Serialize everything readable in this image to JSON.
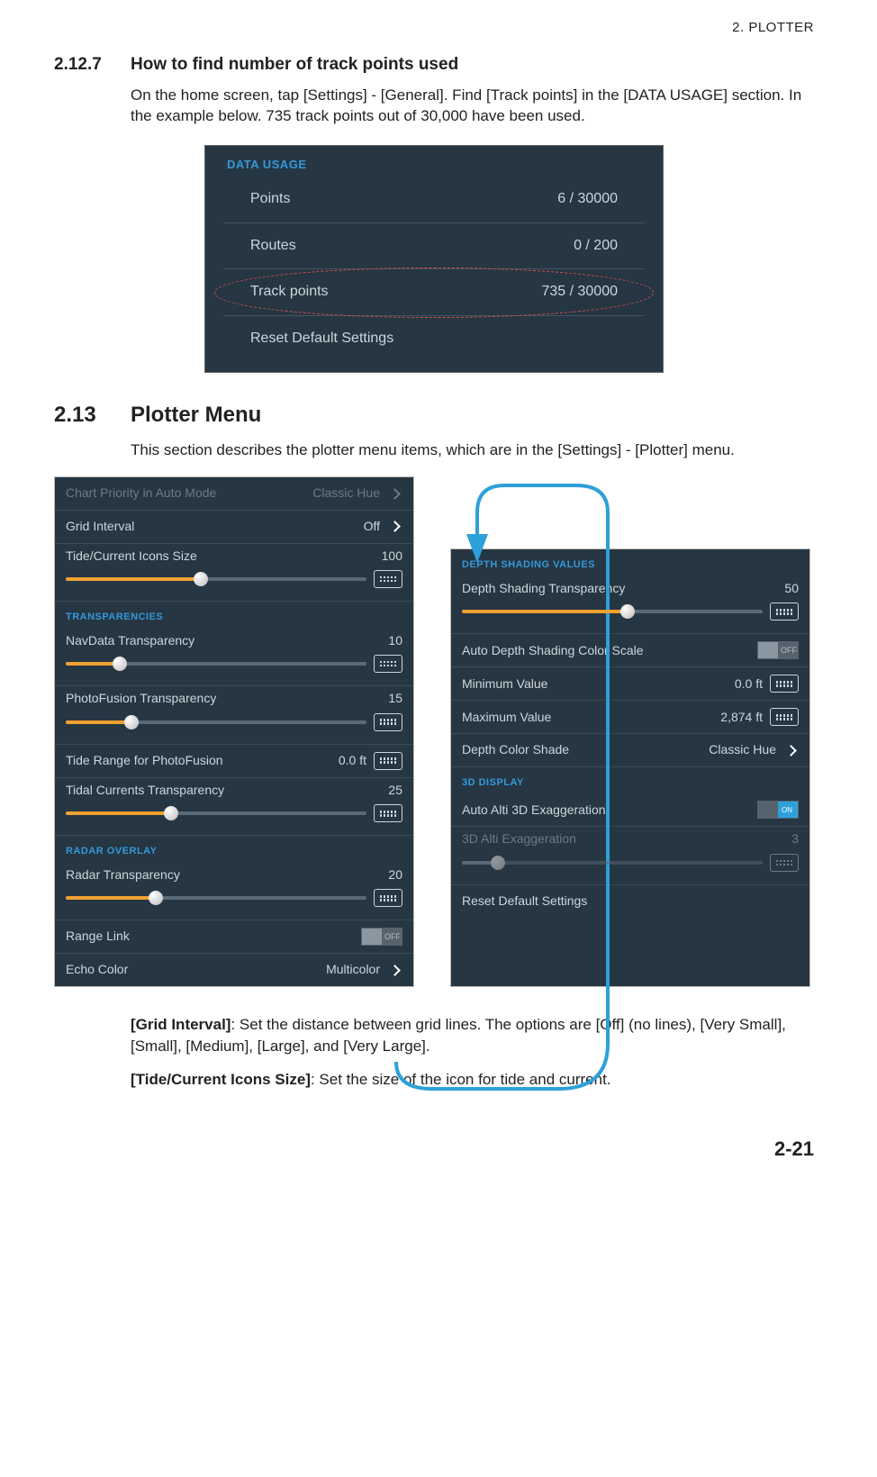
{
  "header": {
    "chapter": "2.  PLOTTER"
  },
  "section1": {
    "num": "2.12.7",
    "title": "How to find number of track points used",
    "body": "On the home screen, tap [Settings] - [General]. Find [Track points] in the [DATA USAGE] section. In the example below. 735 track points out of 30,000 have been used."
  },
  "data_usage": {
    "title": "DATA USAGE",
    "rows": [
      {
        "label": "Points",
        "value": "6 / 30000"
      },
      {
        "label": "Routes",
        "value": "0 / 200"
      },
      {
        "label": "Track points",
        "value": "735 / 30000"
      },
      {
        "label": "Reset Default Settings",
        "value": ""
      }
    ]
  },
  "section2": {
    "num": "2.13",
    "title": "Plotter Menu",
    "body": "This section describes the plotter menu items, which are in the [Settings] - [Plotter] menu."
  },
  "panel_left": {
    "chart_priority": {
      "label": "Chart Priority in Auto Mode",
      "value": "Classic Hue"
    },
    "grid_interval": {
      "label": "Grid Interval",
      "value": "Off"
    },
    "tide_icons": {
      "label": "Tide/Current Icons Size",
      "value": "100",
      "percent": 45
    },
    "trans_title": "TRANSPARENCIES",
    "navdata": {
      "label": "NavData Transparency",
      "value": "10",
      "percent": 18
    },
    "photo": {
      "label": "PhotoFusion Transparency",
      "value": "15",
      "percent": 22
    },
    "tide_range": {
      "label": "Tide Range for PhotoFusion",
      "value": "0.0 ft"
    },
    "tidal_curr": {
      "label": "Tidal Currents Transparency",
      "value": "25",
      "percent": 35
    },
    "radar_title": "RADAR OVERLAY",
    "radar_trans": {
      "label": "Radar Transparency",
      "value": "20",
      "percent": 30
    },
    "range_link": {
      "label": "Range Link",
      "value": "OFF"
    },
    "echo": {
      "label": "Echo Color",
      "value": "Multicolor"
    }
  },
  "panel_right": {
    "depth_title": "DEPTH SHADING VALUES",
    "depth_trans": {
      "label": "Depth Shading Transparency",
      "value": "50",
      "percent": 55
    },
    "auto_color": {
      "label": "Auto Depth Shading Color Scale",
      "value": "OFF"
    },
    "min": {
      "label": "Minimum Value",
      "value": "0.0 ft"
    },
    "max": {
      "label": "Maximum Value",
      "value": "2,874 ft"
    },
    "shade": {
      "label": "Depth Color Shade",
      "value": "Classic Hue"
    },
    "d3_title": "3D DISPLAY",
    "auto_alti": {
      "label": "Auto Alti 3D Exaggeration",
      "value": "ON"
    },
    "alti": {
      "label": "3D Alti Exaggeration",
      "value": "3",
      "percent": 12
    },
    "reset": {
      "label": "Reset Default Settings"
    }
  },
  "descriptions": {
    "grid": {
      "title": "[Grid Interval]",
      "body": ": Set the distance between grid lines. The options are [Off] (no lines), [Very Small], [Small], [Medium], [Large], and [Very Large]."
    },
    "tide": {
      "title": "[Tide/Current Icons Size]",
      "body": ": Set the size of the icon for tide and current."
    }
  },
  "page": "2-21"
}
